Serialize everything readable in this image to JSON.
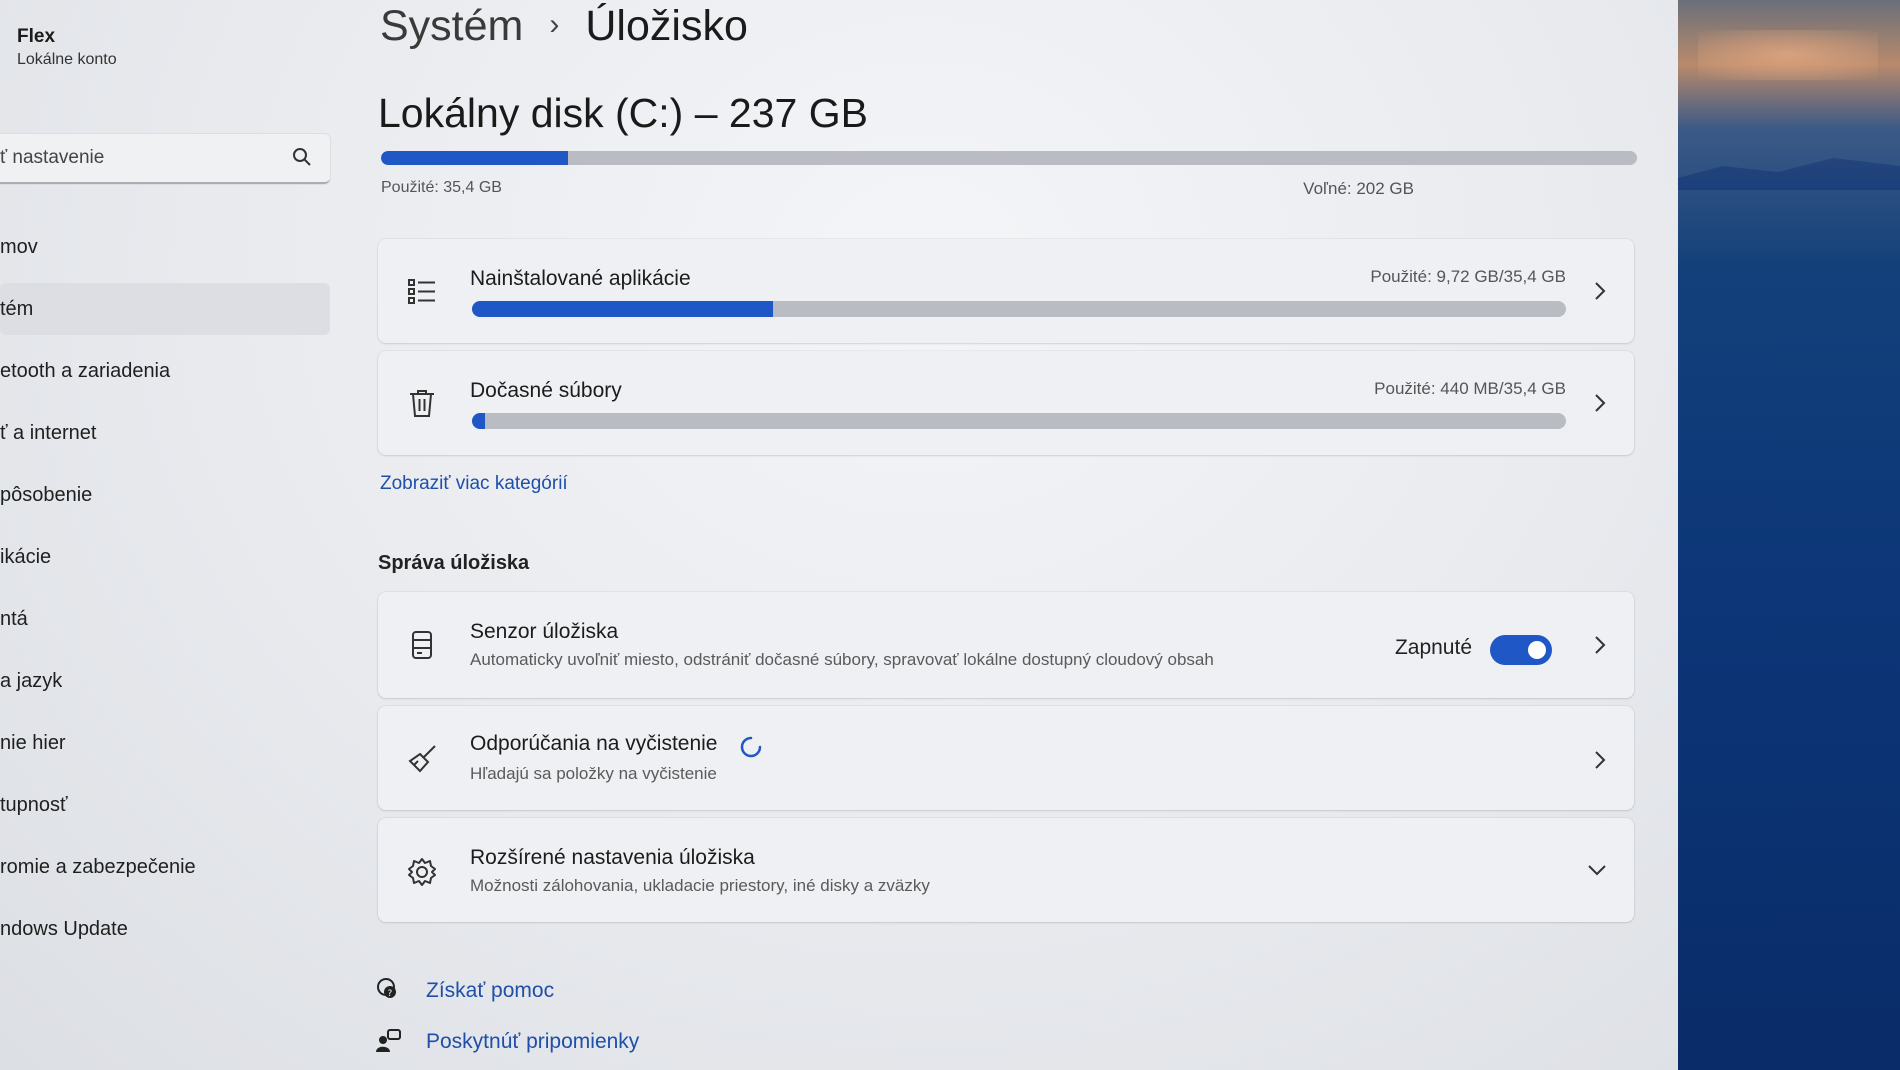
{
  "account": {
    "name": "Flex",
    "type": "Lokálne konto"
  },
  "search": {
    "placeholder": "ť nastavenie"
  },
  "sidebar": {
    "items": [
      {
        "label": "mov"
      },
      {
        "label": "tém",
        "selected": true
      },
      {
        "label": "etooth a zariadenia"
      },
      {
        "label": "ť a internet"
      },
      {
        "label": "pôsobenie"
      },
      {
        "label": "ikácie"
      },
      {
        "label": "ntá"
      },
      {
        "label": "a jazyk"
      },
      {
        "label": "nie hier"
      },
      {
        "label": "tupnosť"
      },
      {
        "label": "romie a zabezpečenie"
      },
      {
        "label": "ndows Update"
      }
    ]
  },
  "breadcrumb": {
    "parent": "Systém",
    "current": "Úložisko"
  },
  "disk": {
    "title": "Lokálny disk (C:) – 237 GB",
    "used_label": "Použité: 35,4 GB",
    "free_label": "Voľné: 202 GB",
    "used_fraction": 0.149
  },
  "categories": [
    {
      "title": "Nainštalované aplikácie",
      "meta": "Použité: 9,72 GB/35,4 GB",
      "used_fraction": 0.275,
      "icon": "list-icon"
    },
    {
      "title": "Dočasné súbory",
      "meta": "Použité: 440 MB/35,4 GB",
      "used_fraction": 0.012,
      "icon": "trash-icon"
    }
  ],
  "more_categories_link": "Zobraziť viac kategórií",
  "management": {
    "heading": "Správa úložiska",
    "storage_sense": {
      "title": "Senzor úložiska",
      "desc": "Automaticky uvoľniť miesto, odstrániť dočasné súbory, spravovať lokálne dostupný cloudový obsah",
      "state_label": "Zapnuté",
      "enabled": true
    },
    "cleanup": {
      "title": "Odporúčania na vyčistenie",
      "desc": "Hľadajú sa položky na vyčistenie"
    },
    "advanced": {
      "title": "Rozšírené nastavenia úložiska",
      "desc": "Možnosti zálohovania, ukladacie priestory, iné disky a zväzky"
    }
  },
  "footer": {
    "help": "Získať pomoc",
    "feedback": "Poskytnúť pripomienky"
  },
  "colors": {
    "accent": "#1f57c7",
    "link": "#1f4fa8",
    "track": "#b9bcc2"
  }
}
